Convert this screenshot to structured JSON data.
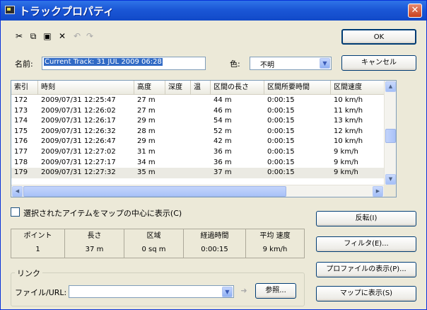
{
  "window": {
    "title": "トラックプロパティ"
  },
  "toolbar": {
    "cut_icon": "scissors-icon",
    "copy_icon": "copy-icon",
    "paste_icon": "paste-icon",
    "delete_icon": "x-icon",
    "undo_icon": "undo-icon",
    "redo_icon": "redo-icon"
  },
  "buttons": {
    "ok": "OK",
    "cancel": "キャンセル",
    "reverse": "反転(I)",
    "filter": "フィルタ(E)...",
    "show_profile": "プロファイルの表示(P)...",
    "show_on_map": "マップに表示(S)",
    "browse": "参照..."
  },
  "fields": {
    "name_label": "名前:",
    "name_value": "Current Track: 31 JUL 2009 06:28",
    "color_label": "色:",
    "color_value": "不明"
  },
  "table": {
    "columns": [
      "索引",
      "時刻",
      "高度",
      "深度",
      "温",
      "区間の長さ",
      "区間所要時間",
      "区間速度"
    ],
    "rows": [
      [
        "172",
        "2009/07/31 12:25:47",
        "27 m",
        "",
        "",
        "44 m",
        "0:00:15",
        "10 km/h"
      ],
      [
        "173",
        "2009/07/31 12:26:02",
        "27 m",
        "",
        "",
        "46 m",
        "0:00:15",
        "11 km/h"
      ],
      [
        "174",
        "2009/07/31 12:26:17",
        "29 m",
        "",
        "",
        "54 m",
        "0:00:15",
        "13 km/h"
      ],
      [
        "175",
        "2009/07/31 12:26:32",
        "28 m",
        "",
        "",
        "52 m",
        "0:00:15",
        "12 km/h"
      ],
      [
        "176",
        "2009/07/31 12:26:47",
        "29 m",
        "",
        "",
        "42 m",
        "0:00:15",
        "10 km/h"
      ],
      [
        "177",
        "2009/07/31 12:27:02",
        "31 m",
        "",
        "",
        "36 m",
        "0:00:15",
        "9 km/h"
      ],
      [
        "178",
        "2009/07/31 12:27:17",
        "34 m",
        "",
        "",
        "36 m",
        "0:00:15",
        "9 km/h"
      ],
      [
        "179",
        "2009/07/31 12:27:32",
        "35 m",
        "",
        "",
        "37 m",
        "0:00:15",
        "9 km/h"
      ]
    ]
  },
  "center_option": {
    "label": "選択されたアイテムをマップの中心に表示(C)"
  },
  "stats": {
    "headers": [
      "ポイント",
      "長さ",
      "区域",
      "経過時間",
      "平均 速度"
    ],
    "values": [
      "1",
      "37 m",
      "0 sq m",
      "0:00:15",
      "9 km/h"
    ]
  },
  "link": {
    "group_label": "リンク",
    "url_label": "ファイル/URL:",
    "url_value": ""
  }
}
